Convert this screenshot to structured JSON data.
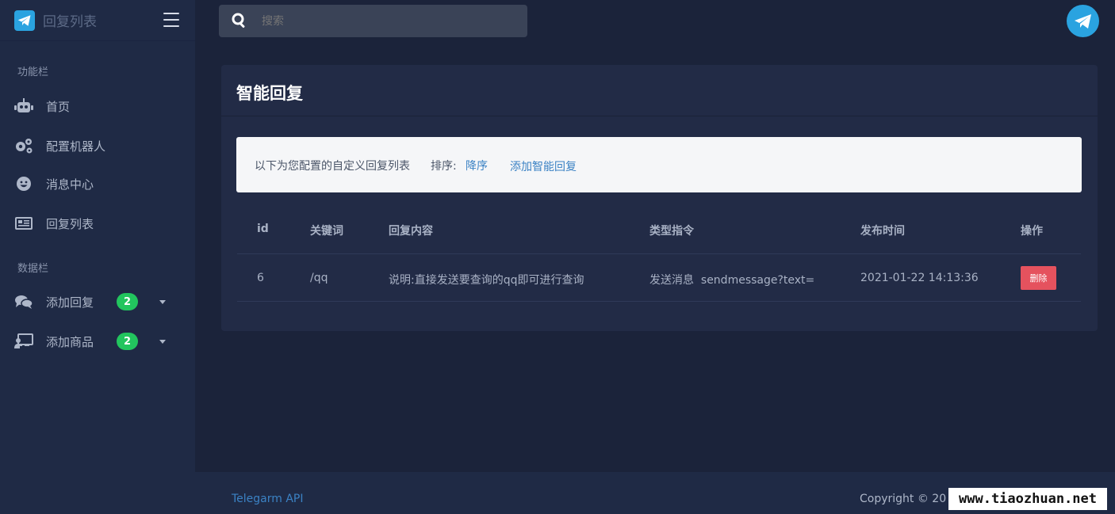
{
  "brand": {
    "title": "回复列表"
  },
  "search": {
    "placeholder": "搜索"
  },
  "sidebar": {
    "section_function": "功能栏",
    "section_data": "数据栏",
    "items": [
      {
        "label": "首页",
        "icon": "robot-icon"
      },
      {
        "label": "配置机器人",
        "icon": "gears-icon"
      },
      {
        "label": "消息中心",
        "icon": "smile-icon"
      },
      {
        "label": "回复列表",
        "icon": "list-icon"
      },
      {
        "label": "添加回复",
        "icon": "comments-icon",
        "badge": "2"
      },
      {
        "label": "添加商品",
        "icon": "presentation-icon",
        "badge": "2"
      }
    ]
  },
  "card": {
    "title": "智能回复",
    "info_text": "以下为您配置的自定义回复列表",
    "sort_label": "排序:",
    "sort_link": "降序",
    "add_link": "添加智能回复"
  },
  "table": {
    "headers": [
      "id",
      "关键词",
      "回复内容",
      "类型指令",
      "发布时间",
      "操作"
    ],
    "rows": [
      {
        "id": "6",
        "keyword": "/qq",
        "content": "说明:直接发送要查询的qq即可进行查询",
        "type": "发送消息  sendmessage?text=",
        "time": "2021-01-22 14:13:36",
        "action": "删除"
      }
    ]
  },
  "footer": {
    "link": "Telegarm API",
    "copyright": "Copyright © 20"
  },
  "watermark": "www.tiaozhuan.net",
  "colors": {
    "accent": "#3b82c4",
    "badge": "#22c55e",
    "danger": "#e5525e",
    "telegram": "#2aa3e0"
  }
}
